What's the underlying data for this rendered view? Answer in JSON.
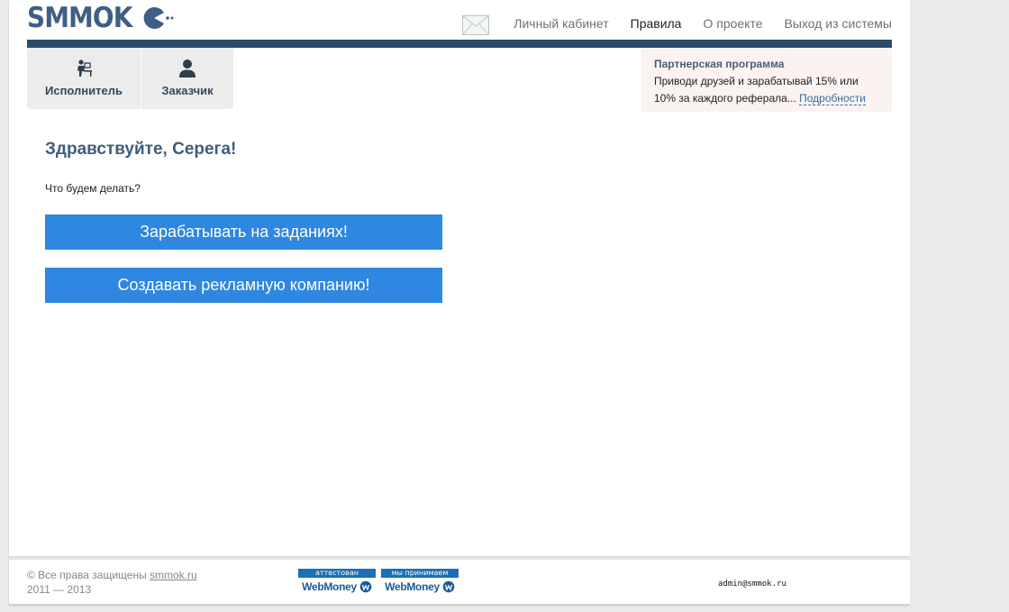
{
  "header": {
    "logo_text": "SMMOK",
    "nav": {
      "cabinet": "Личный кабинет",
      "rules": "Правила",
      "about": "О проекте",
      "logout": "Выход из системы"
    }
  },
  "tabs": {
    "performer": "Исполнитель",
    "customer": "Заказчик"
  },
  "partner": {
    "title": "Партнерская программа",
    "text": "Приводи друзей и зарабатывай 15% или 10% за каждого реферала...",
    "more": "Подробности"
  },
  "main": {
    "greeting": "Здравствуйте, Серега!",
    "question": "Что будем делать?",
    "earn_button": "Зарабатывать на заданиях!",
    "create_button": "Создавать рекламную компанию!"
  },
  "footer": {
    "copyright_prefix": "© Все права защищены ",
    "site_link": "smmok.ru",
    "years": "2011 — 2013",
    "wm_attested_top": "аттестован",
    "wm_accept_top": "мы принимаем",
    "wm_brand": "WebMoney",
    "admin_email": "admin@smmok.ru"
  },
  "colors": {
    "brand": "#3d5f85",
    "topbar": "#2c4b6b",
    "button": "#2e87e1"
  }
}
